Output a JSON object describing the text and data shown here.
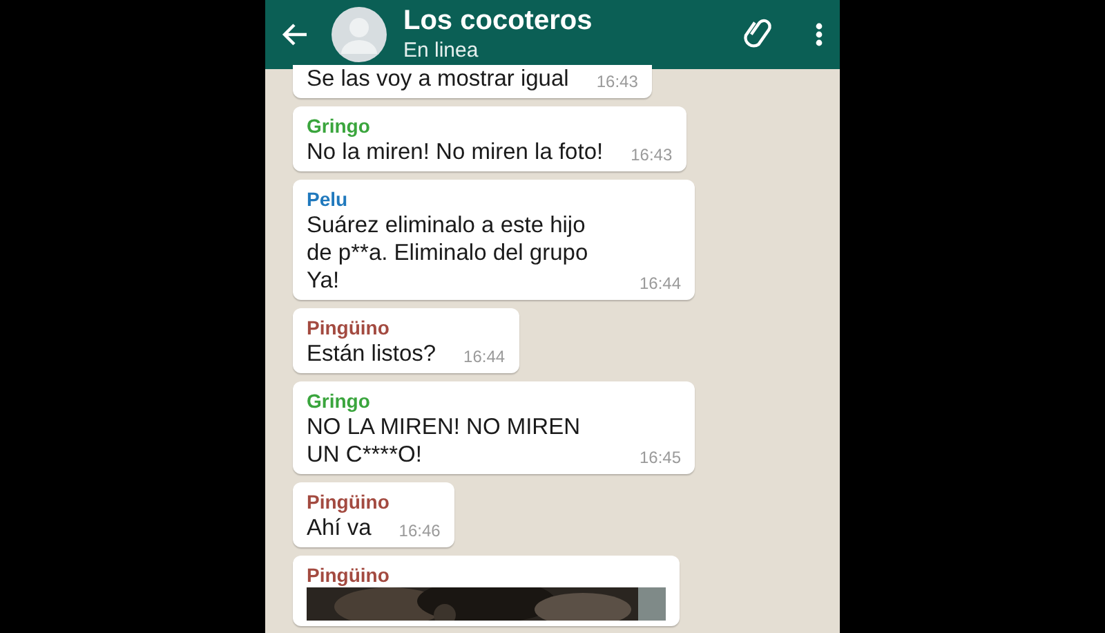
{
  "header": {
    "title": "Los cocoteros",
    "status": "En linea"
  },
  "messages": [
    {
      "kind": "text",
      "text": "Se las voy a mostrar igual",
      "time": "16:43"
    },
    {
      "kind": "text",
      "sender": "Gringo",
      "color": "#3aa53d",
      "text": "No la miren! No miren la foto!",
      "time": "16:43"
    },
    {
      "kind": "text",
      "sender": "Pelu",
      "color": "#2079bd",
      "text": "Suárez eliminalo a este hijo de p**a. Eliminalo del grupo Ya!",
      "time": "16:44"
    },
    {
      "kind": "text",
      "sender": "Pingüino",
      "color": "#a34a40",
      "text": "Están listos?",
      "time": "16:44"
    },
    {
      "kind": "text",
      "sender": "Gringo",
      "color": "#3aa53d",
      "text": "NO LA MIREN! NO MIREN UN C****O!",
      "time": "16:45"
    },
    {
      "kind": "text",
      "sender": "Pingüino",
      "color": "#a34a40",
      "text": "Ahí va",
      "time": "16:46"
    },
    {
      "sender": "Pingüino",
      "color": "#a34a40"
    }
  ]
}
